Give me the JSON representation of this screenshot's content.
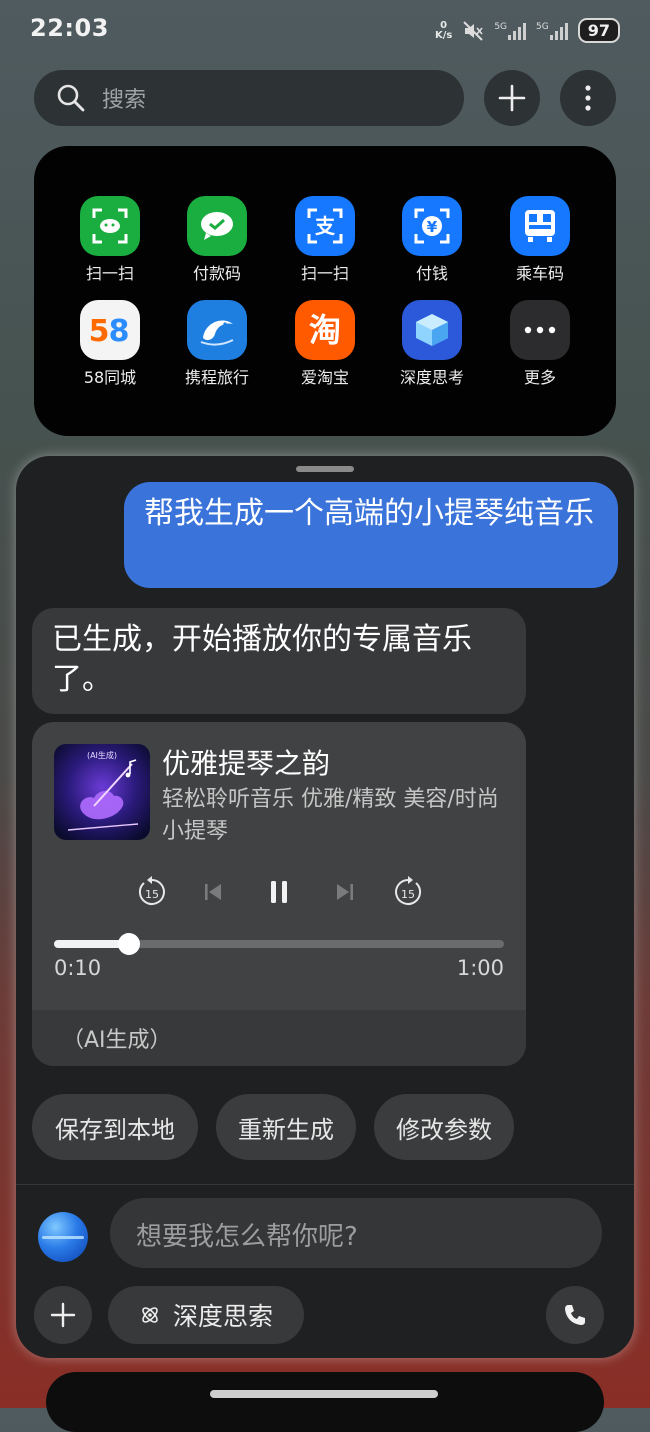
{
  "status_bar": {
    "time": "22:03",
    "net_speed_value": "0",
    "net_speed_unit": "K/s",
    "sim1": "5G",
    "sim2": "5G",
    "battery": "97"
  },
  "search": {
    "placeholder": "搜索"
  },
  "shortcuts": [
    {
      "label": "扫一扫",
      "icon": "wechat-scan-icon",
      "color": "#1aad3f"
    },
    {
      "label": "付款码",
      "icon": "wechat-pay-icon",
      "color": "#1aad3f"
    },
    {
      "label": "扫一扫",
      "icon": "alipay-scan-icon",
      "color": "#1677ff"
    },
    {
      "label": "付钱",
      "icon": "alipay-pay-icon",
      "color": "#1677ff"
    },
    {
      "label": "乘车码",
      "icon": "bus-code-icon",
      "color": "#1677ff"
    },
    {
      "label": "58同城",
      "icon": "58-logo-icon",
      "color": "#f4f4f4"
    },
    {
      "label": "携程旅行",
      "icon": "ctrip-dolphin-icon",
      "color": "#1e7fe0"
    },
    {
      "label": "爱淘宝",
      "icon": "taobao-icon",
      "color": "#ff5a00"
    },
    {
      "label": "深度思考",
      "icon": "deep-think-cube-icon",
      "color": "#2b59d9"
    },
    {
      "label": "更多",
      "icon": "more-dots-icon",
      "color": "#2c2c2e"
    }
  ],
  "chat": {
    "user_message": "帮我生成一个高端的小提琴纯音乐",
    "bot_message": "已生成，开始播放你的专属音乐了。",
    "player": {
      "cover_badge": "(AI生成)",
      "title": "优雅提琴之韵",
      "description": "轻松聆听音乐 优雅/精致 美容/时尚 小提琴",
      "rewind_seconds": "15",
      "forward_seconds": "15",
      "current_time": "0:10",
      "total_time": "1:00",
      "progress": 0.1667,
      "ai_tag": "（AI生成）"
    },
    "actions": [
      "保存到本地",
      "重新生成",
      "修改参数"
    ]
  },
  "composer": {
    "placeholder": "想要我怎么帮你呢?",
    "deep_search_label": "深度思索"
  }
}
